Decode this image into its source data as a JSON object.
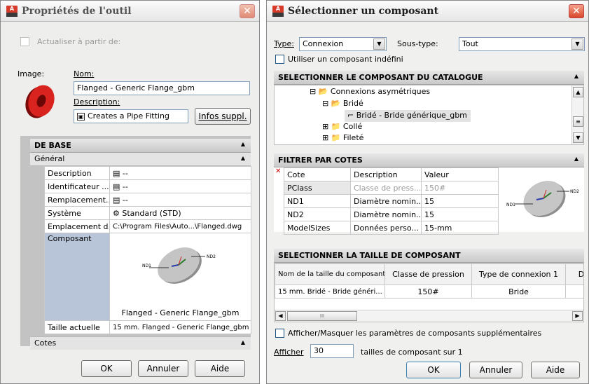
{
  "left": {
    "title": "Propriétés de l'outil",
    "refresh_label": "Actualiser à partir de:",
    "image_label": "Image:",
    "name_label": "Nom:",
    "name_value": "Flanged - Generic Flange_gbm",
    "description_label": "Description:",
    "description_value": "Creates a Pipe Fitting",
    "more_info_label": "Infos suppl.",
    "section_base": "DE BASE",
    "group_general": "Général",
    "rows": [
      {
        "name": "Description",
        "value": "--"
      },
      {
        "name": "Identificateur ...",
        "value": "--"
      },
      {
        "name": "Remplacement...",
        "value": "--"
      },
      {
        "name": "Système",
        "value": "Standard (STD)"
      },
      {
        "name": "Emplacement d...",
        "value": "C:\\Program Files\\Auto...\\Flanged.dwg"
      }
    ],
    "component_label": "Composant",
    "component_caption": "Flanged - Generic Flange_gbm",
    "nd1": "ND1",
    "nd2": "ND2",
    "size_label": "Taille actuelle",
    "size_value": "15 mm. Flanged - Generic Flange_gbm",
    "group_cotes": "Cotes",
    "ok": "OK",
    "cancel": "Annuler",
    "help": "Aide"
  },
  "right": {
    "title": "Sélectionner un composant",
    "type_label": "Type:",
    "type_value": "Connexion",
    "subtype_label": "Sous-type:",
    "subtype_value": "Tout",
    "undefined_label": "Utiliser un composant indéfini",
    "catalog_header": "SELECTIONNER LE COMPOSANT DU CATALOGUE",
    "tree": [
      "Connexions asymétriques",
      "Bridé",
      "Bridé - Bride générique_gbm",
      "Collé",
      "Fileté"
    ],
    "filter_header": "FILTRER PAR COTES",
    "filter_cols": [
      "Cote",
      "Description",
      "Valeur"
    ],
    "filter_rows": [
      {
        "cote": "PClass",
        "desc": "Classe de press...",
        "val": "150#"
      },
      {
        "cote": "ND1",
        "desc": "Diamètre nomin...",
        "val": "15"
      },
      {
        "cote": "ND2",
        "desc": "Diamètre nomin...",
        "val": "15"
      },
      {
        "cote": "ModelSizes",
        "desc": "Données perso...",
        "val": "15-mm"
      }
    ],
    "size_header": "SELECTIONNER LA TAILLE DE COMPOSANT",
    "size_cols": [
      "Nom de la taille du composant",
      "Classe de pression",
      "Type de connexion 1",
      "D"
    ],
    "size_rows": [
      {
        "name": "15 mm. Bridé - Bride généri...",
        "pclass": "150#",
        "conn": "Bride"
      }
    ],
    "scroll_mid": "III",
    "show_hide_label": "Afficher/Masquer les paramètres de composants supplémentaires",
    "show_label": "Afficher",
    "show_value": "30",
    "show_suffix": "tailles de composant sur 1",
    "nd1": "ND1",
    "nd2": "ND2",
    "ok": "OK",
    "cancel": "Annuler",
    "help": "Aide"
  }
}
